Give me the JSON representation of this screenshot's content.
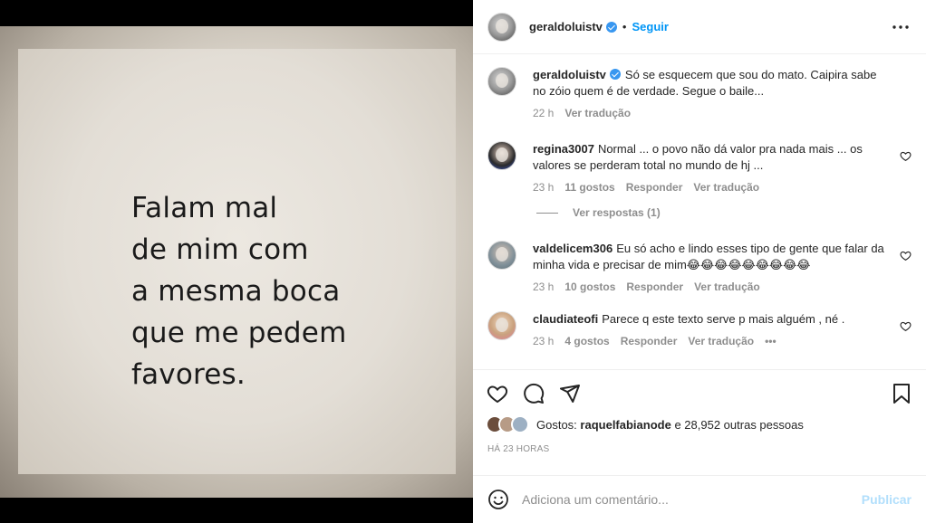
{
  "media": {
    "quote": "Falam mal\nde mim com\na mesma boca\nque me pedem\nfavores."
  },
  "header": {
    "username": "geraldoluistv",
    "separator": "•",
    "follow_label": "Seguir",
    "more_icon": "more-options-icon"
  },
  "caption": {
    "username": "geraldoluistv",
    "text": "Só se esquecem que sou do mato. Caipira sabe no zóio quem é de verdade. Segue o baile...",
    "time": "22 h",
    "translate_label": "Ver tradução"
  },
  "comments": [
    {
      "username": "regina3007",
      "text": "Normal ... o povo não dá valor pra nada mais ... os valores se perderam total no mundo de hj ...",
      "time": "23 h",
      "likes": "11 gostos",
      "reply_label": "Responder",
      "translate_label": "Ver tradução",
      "avatar_color": "#3b5bdb"
    },
    {
      "username": "valdelicem306",
      "text": "Eu só acho e lindo esses tipo de gente que falar da minha vida e precisar de mim😂😂😂😂😂😂😂😂😂",
      "time": "23 h",
      "likes": "10 gostos",
      "reply_label": "Responder",
      "translate_label": "Ver tradução",
      "avatar_color": "#8aa0a8"
    },
    {
      "username": "claudiateofi",
      "text": "Parece q este texto serve p mais alguém , né .",
      "time": "23 h",
      "likes": "4 gostos",
      "reply_label": "Responder",
      "translate_label": "Ver tradução",
      "more_label": "•••",
      "avatar_color": "#c9a27e"
    }
  ],
  "view_replies_label": "Ver respostas (1)",
  "likes": {
    "prefix": "Gostos:",
    "user": "raquelfabianode",
    "suffix": "e 28,952 outras pessoas"
  },
  "timestamp": "HÁ 23 HORAS",
  "comment_box": {
    "placeholder": "Adiciona um comentário...",
    "post_label": "Publicar"
  },
  "colors": {
    "accent": "#0095f6",
    "post_disabled": "#b2dffc",
    "muted": "#8e8e8e",
    "verified": "#3897f0"
  }
}
